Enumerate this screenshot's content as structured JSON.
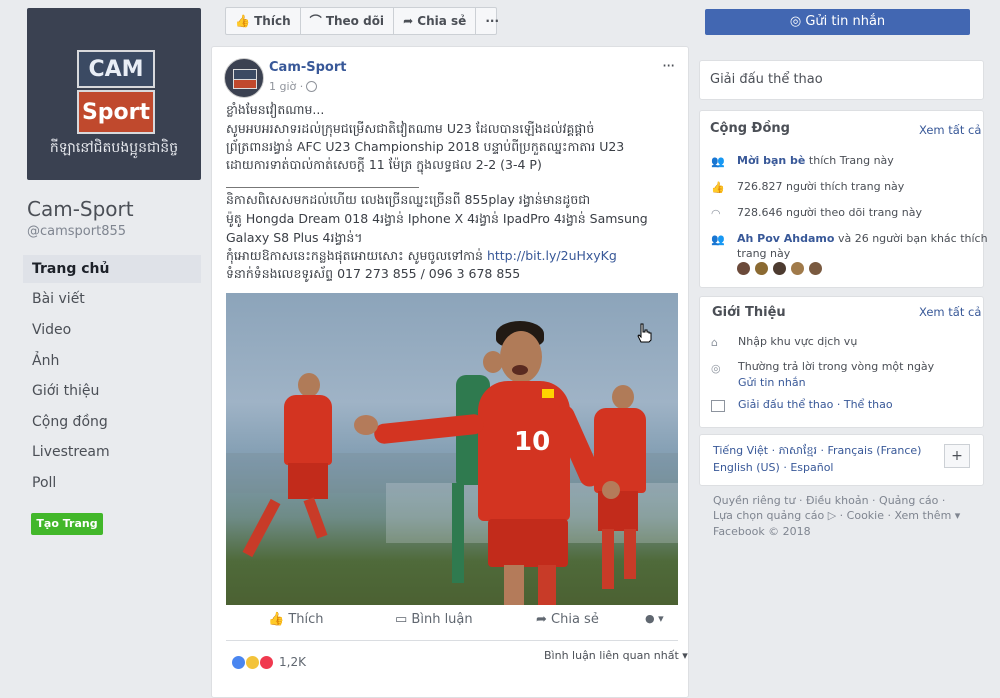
{
  "cover": {
    "logo_top": "CAM",
    "logo_bottom": "Sport",
    "tagline": "កីឡានៅជិតបងប្អូនជានិច្ច"
  },
  "page": {
    "name": "Cam-Sport",
    "handle": "@camsport855"
  },
  "nav": [
    "Trang chủ",
    "Bài viết",
    "Video",
    "Ảnh",
    "Giới thiệu",
    "Cộng đồng",
    "Livestream",
    "Poll"
  ],
  "create_page": "Tạo Trang",
  "action_bar": {
    "like": "Thích",
    "follow": "Theo dõi",
    "share": "Chia sẻ",
    "more": "···"
  },
  "send_message": "Gửi tin nhắn",
  "post": {
    "author": "Cam-Sport",
    "time": "1 giờ ·",
    "more": "···",
    "lines": [
      "ខ្លាំងមែនវៀតណាម...",
      "សូមអបអរសាទរដល់ក្រុមជម្រើសជាតិវៀតណាម U23 ដែលបានឡើងដល់វគ្គផ្តាច់",
      "ព្រ័ត្រពានរង្វាន់ AFC U23 Championship 2018 បន្ទាប់ពីប្រកួតឈ្នះកាតារ U23",
      "ដោយការទាត់បាល់កាត់សេចក្តី 11 ម៉ែត្រ ក្នុងលទ្ធផល 2-2 (3-4 P)"
    ],
    "promo_lines": [
      "និកាសពិសេសមកដល់ហើយ លេងច្រើនឈ្នះច្រើនពី 855play រង្វាន់មានដូចជា",
      "ម៉ូតូ Hongda Dream 018 4រង្វាន់ Iphone X 4រង្វាន់ IpadPro 4រង្វាន់ Samsung",
      "Galaxy S8 Plus 4រង្វាន់។",
      "កុំអោយឱកាសនេះកន្លងផុតអោយសោះ សូមចូលទៅកាន់"
    ],
    "link": "http://bit.ly/2uHxyKg",
    "contact": "ទំនាក់ទំនងលេខទូរស័ព្ទ 017 273 855 / 096 3 678 855",
    "jersey_number": "10",
    "actions": {
      "like": "Thích",
      "comment": "Bình luận",
      "share": "Chia sẻ"
    },
    "reaction_count": "1,2K",
    "comment_filter": "Bình luận liên quan nhất ▾"
  },
  "right": {
    "category": "Giải đấu thể thao",
    "community": {
      "title": "Cộng Đồng",
      "see_all": "Xem tất cả",
      "invite": "Mời bạn bè",
      "invite_suffix": "thích Trang này",
      "likes": "726.827 người thích trang này",
      "follows": "728.646 người theo dõi trang này",
      "friend_name": "Ah Pov Ahdamo",
      "friend_suffix": "và 26 người bạn khác thích",
      "friend_suffix2": "trang này"
    },
    "about": {
      "title": "Giới Thiệu",
      "see_all": "Xem tất cả",
      "service": "Nhập khu vực dịch vụ",
      "response": "Thường trả lời trong vòng một ngày",
      "send": "Gửi tin nhắn",
      "category": "Giải đấu thể thao · Thể thao"
    },
    "languages": {
      "line1": "Tiếng Việt · ភាសាខ្មែរ · Français (France)",
      "line2": "English (US) · Español",
      "plus": "+"
    },
    "footer": {
      "line1": "Quyền riêng tư · Điều khoản · Quảng cáo ·",
      "line2": "Lựa chọn quảng cáo ▷ · Cookie · Xem thêm ▾",
      "line3": "Facebook © 2018"
    }
  }
}
